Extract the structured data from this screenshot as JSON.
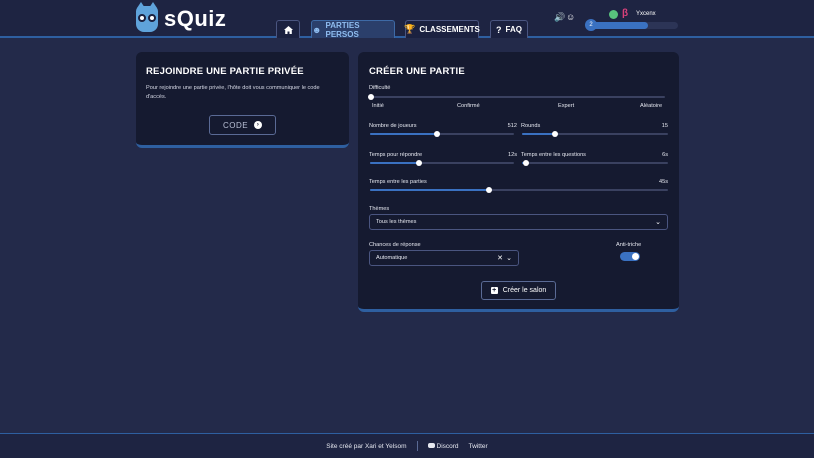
{
  "app": {
    "brand": "sQuiz"
  },
  "nav": {
    "home_icon": "home-icon",
    "parties_persos": "PARTIES PERSOS",
    "classements": "CLASSEMENTS",
    "faq": "FAQ"
  },
  "user": {
    "beta": "β",
    "username": "Yxcenx",
    "level": "2",
    "level_progress": 0.67
  },
  "join": {
    "title": "REJOINDRE UNE PARTIE PRIVÉE",
    "description": "Pour rejoindre une partie privée, l'hôte doit vous communiquer le code d'accès.",
    "code_placeholder": "CODE"
  },
  "create": {
    "title": "CRÉER UNE PARTIE",
    "difficulty": {
      "label": "Difficulté",
      "levels": [
        "Initié",
        "Confirmé",
        "Expert",
        "Aléatoire"
      ],
      "value": 0
    },
    "players": {
      "label": "Nombre de joueurs",
      "value": "512",
      "fraction": 0.5
    },
    "rounds": {
      "label": "Rounds",
      "value": "15",
      "fraction": 0.22
    },
    "answer_time": {
      "label": "Temps pour répondre",
      "value": "12s",
      "fraction": 0.34
    },
    "question_time": {
      "label": "Temps entre les questions",
      "value": "6s",
      "fraction": 0.03
    },
    "game_time": {
      "label": "Temps entre les parties",
      "value": "45s",
      "fraction": 0.4
    },
    "themes": {
      "label": "Thèmes",
      "value": "Tous les thèmes"
    },
    "chances": {
      "label": "Chances de réponse",
      "value": "Automatique"
    },
    "anticheat": {
      "label": "Anti-triche",
      "enabled": true
    },
    "submit_label": "Créer le salon"
  },
  "footer": {
    "credit": "Site créé par Xari et Yelsom",
    "discord": "Discord",
    "twitter": "Twitter"
  },
  "colors": {
    "background": "#232a4a",
    "card": "#151a30",
    "accent": "#3a71c1",
    "accent_light": "#8fbdf0"
  }
}
